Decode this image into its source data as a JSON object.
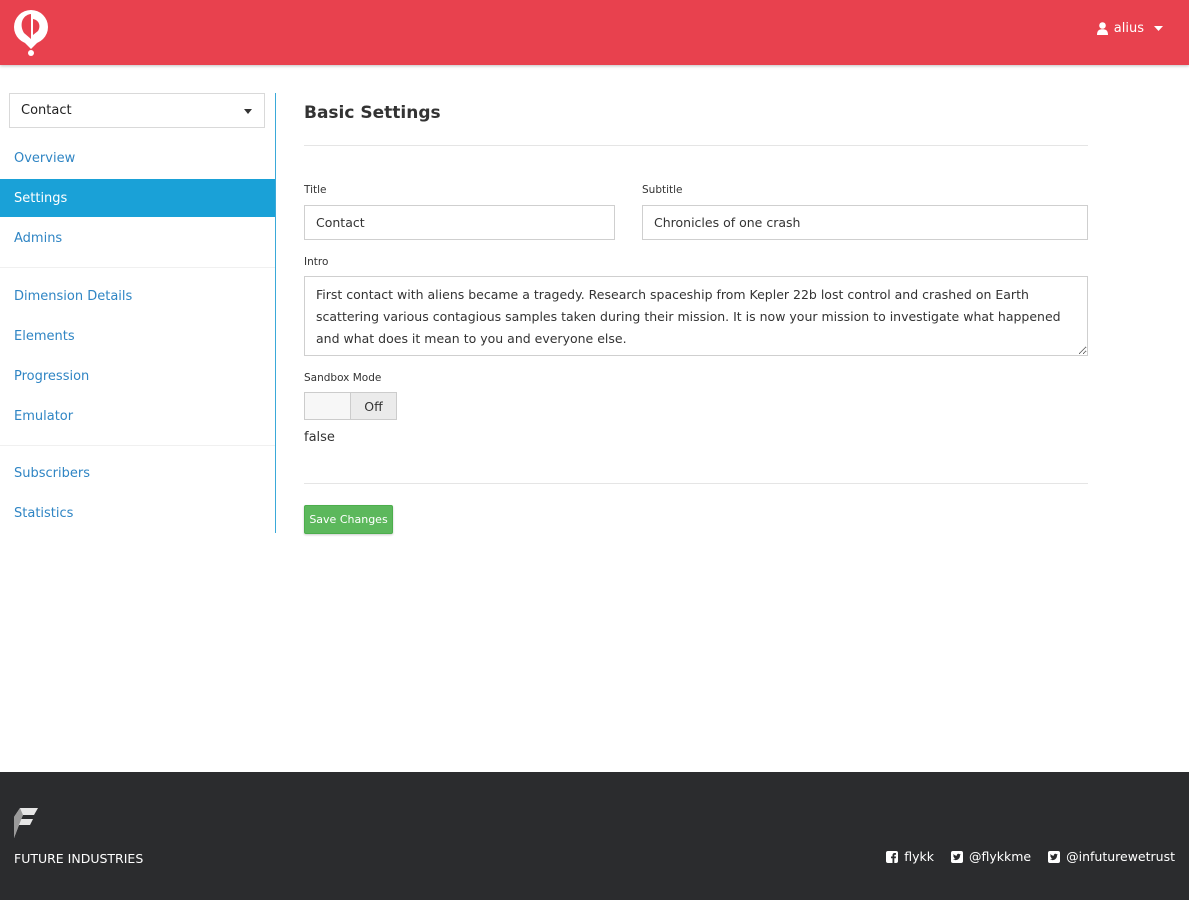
{
  "header": {
    "brand_color": "#e8414e",
    "logo_icon": "balloon-logo-icon",
    "user": {
      "icon": "user-icon",
      "name": "alius",
      "caret_icon": "caret-down-icon"
    }
  },
  "sidebar": {
    "selector": {
      "value": "Contact"
    },
    "items": [
      {
        "label": "Overview",
        "active": false
      },
      {
        "label": "Settings",
        "active": true
      },
      {
        "label": "Admins",
        "active": false
      },
      {
        "label": "Dimension Details",
        "active": false
      },
      {
        "label": "Elements",
        "active": false
      },
      {
        "label": "Progression",
        "active": false
      },
      {
        "label": "Emulator",
        "active": false
      },
      {
        "label": "Subscribers",
        "active": false
      },
      {
        "label": "Statistics",
        "active": false
      }
    ],
    "active_color": "#1aa1d7",
    "link_color": "#2f85c4"
  },
  "main": {
    "title": "Basic Settings",
    "fields": {
      "title": {
        "label": "Title",
        "value": "Contact"
      },
      "subtitle": {
        "label": "Subtitle",
        "value": "Chronicles of one crash"
      },
      "intro": {
        "label": "Intro",
        "value": "First contact with aliens became a tragedy. Research spaceship from Kepler 22b lost control and crashed on Earth scattering various contagious samples taken during their mission. It is now your mission to investigate what happened and what does it mean to you and everyone else."
      },
      "sandbox": {
        "label": "Sandbox Mode",
        "toggle_state": "Off",
        "value_text": "false"
      }
    },
    "save_label": "Save Changes",
    "save_color": "#5cb85c"
  },
  "footer": {
    "background": "#2b2c2e",
    "logo_icon": "future-industries-logo-icon",
    "company": "FUTURE INDUSTRIES",
    "socials": [
      {
        "icon": "facebook-icon",
        "label": "flykk"
      },
      {
        "icon": "twitter-icon",
        "label": "@flykkme"
      },
      {
        "icon": "twitter-icon",
        "label": "@infuturewetrust"
      }
    ]
  }
}
